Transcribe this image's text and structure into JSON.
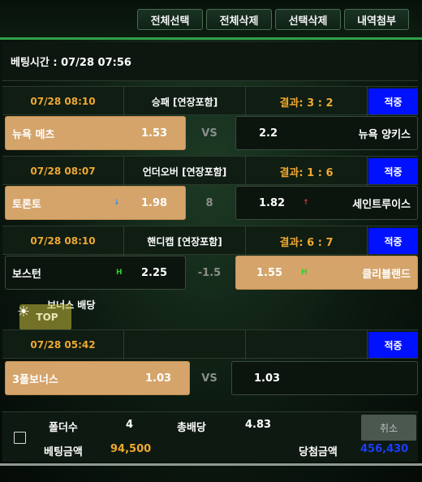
{
  "toolbar": {
    "buttons": [
      "전체선택",
      "전체삭제",
      "선택삭제",
      "내역첨부"
    ]
  },
  "bet_time": "베팅시간 : 07/28 07:56",
  "games": [
    {
      "date": "07/28 08:10",
      "type": "승패 [연장포함]",
      "result": "결과: 3 : 2",
      "status": "적중",
      "home": {
        "name": "뉴욕 메츠",
        "odd": "1.53",
        "selected": true
      },
      "mid": "VS",
      "away": {
        "name": "뉴욕 양키스",
        "odd": "2.2",
        "selected": false
      }
    },
    {
      "date": "07/28 08:07",
      "type": "언더오버 [연장포함]",
      "result": "결과: 1 : 6",
      "status": "적중",
      "home": {
        "name": "토론토",
        "odd": "1.98",
        "selected": true,
        "indicator": "↓"
      },
      "mid": "8",
      "away": {
        "name": "세인트루이스",
        "odd": "1.82",
        "selected": false,
        "indicator": "↑"
      }
    },
    {
      "date": "07/28 08:10",
      "type": "핸디캡 [연장포함]",
      "result": "결과: 6 : 7",
      "status": "적중",
      "home": {
        "name": "보스턴",
        "odd": "2.25",
        "selected": false,
        "indicator": "H"
      },
      "mid": "-1.5",
      "away": {
        "name": "클리블랜드",
        "odd": "1.55",
        "selected": true,
        "indicator": "H"
      }
    },
    {
      "date": "07/28 05:42",
      "type": "",
      "result": "",
      "status": "적중",
      "home": {
        "name": "3폴보너스",
        "odd": "1.03",
        "selected": true
      },
      "mid": "VS",
      "away": {
        "name": "",
        "odd": "1.03",
        "selected": false
      }
    }
  ],
  "bonus_label": "보너스 배당",
  "top_button": "TOP",
  "summary": {
    "folders_label": "폴더수",
    "folders_value": "4",
    "total_odds_label": "총배당",
    "total_odds_value": "4.83",
    "cancel_label": "취소",
    "bet_amount_label": "베팅금액",
    "bet_amount_value": "94,500",
    "win_amount_label": "당첨금액",
    "win_amount_value": "456,430"
  },
  "colors": {
    "accent_orange": "#f0a830",
    "selected_gold": "#d4a46a",
    "status_blue": "#0011ff",
    "bar_green": "#2fa14a",
    "win_blue": "#1a3cff"
  }
}
